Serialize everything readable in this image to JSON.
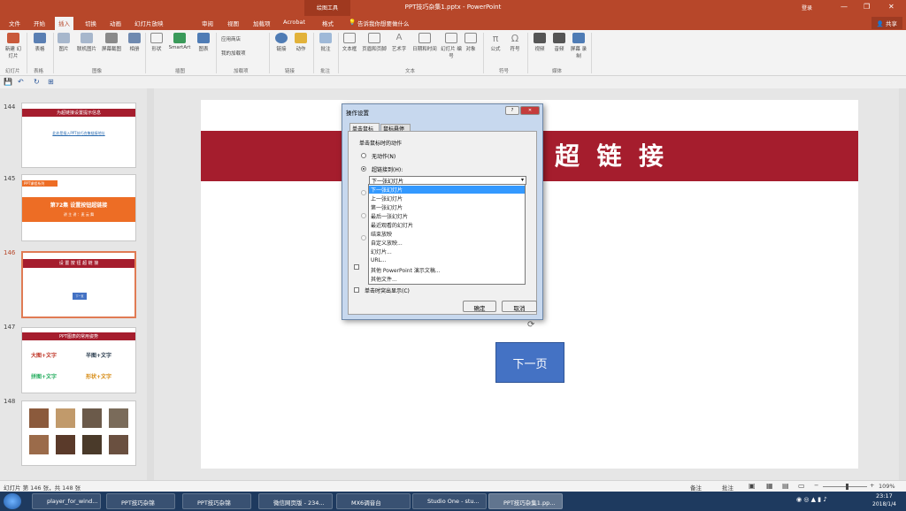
{
  "window": {
    "title": "PPT技巧杂集1.pptx  -  PowerPoint",
    "context_tab_group": "绘图工具",
    "login": "登录",
    "min": "—",
    "max": "❐",
    "close": "✕"
  },
  "tabs": [
    "文件",
    "开始",
    "插入",
    "切换",
    "动画",
    "幻灯片放映",
    "审阅",
    "视图",
    "加载项",
    "Acrobat",
    "格式"
  ],
  "active_tab": "插入",
  "tell_me": "告诉我你想要做什么",
  "share_label": "共享",
  "ribbon": {
    "buttons": [
      "新建\n幻灯片",
      "表格",
      "图片",
      "联机图片",
      "屏幕截图",
      "相册",
      "形状",
      "SmartArt",
      "图表",
      "应用商店",
      "我的加载项",
      "链接",
      "动作",
      "批注",
      "文本框",
      "页眉和页脚",
      "艺术字",
      "日期和时间",
      "幻灯片\n编号",
      "对象",
      "公式",
      "符号",
      "视频",
      "音频",
      "屏幕\n录制"
    ],
    "groups": [
      "幻灯片",
      "表格",
      "图像",
      "插图",
      "加载项",
      "链接",
      "批注",
      "文本",
      "符号",
      "媒体"
    ]
  },
  "quick_access": [
    "💾",
    "↶",
    "↻",
    "⊞"
  ],
  "thumbnails": [
    {
      "num": "144",
      "title": "为超链接设置提示信息",
      "body": "此处是插入PPT技巧合集链接地址"
    },
    {
      "num": "145",
      "tag": "PPT课程系列",
      "title": "第72集  设置按钮超链接",
      "sub": "讲 主 讲 ：麦 云 舞"
    },
    {
      "num": "146",
      "title": "设 置 按 钮 超 链 接",
      "btn": "下一页"
    },
    {
      "num": "147",
      "title": "PPT图表的常用姿势",
      "items": [
        "大图+文字",
        "半图+文字",
        "拼图+文字",
        "形状+文字"
      ]
    },
    {
      "num": "148"
    }
  ],
  "slide": {
    "banner_title": "超  链  接",
    "next_button": "下一页"
  },
  "dialog": {
    "title": "操作设置",
    "help": "?",
    "close": "✕",
    "tabs": [
      "单击鼠标",
      "鼠标悬停"
    ],
    "section": "单击鼠标时的动作",
    "options": [
      "无动作(N)",
      "超链接到(H):"
    ],
    "combo_value": "下一张幻灯片",
    "list_items": [
      "下一张幻灯片",
      "上一张幻灯片",
      "第一张幻灯片",
      "最后一张幻灯片",
      "最近观看的幻灯片",
      "结束放映",
      "自定义放映...",
      "幻灯片...",
      "URL...",
      "其他 PowerPoint 演示文稿...",
      "其他文件..."
    ],
    "check_label": "单击时突出显示(C)",
    "ok": "确定",
    "cancel": "取消"
  },
  "statusbar": {
    "slide_info": "幻灯片 第 146 张，共 148 张",
    "notes": "备注",
    "comments": "批注",
    "zoom": "109%"
  },
  "taskbar": {
    "items": [
      "player_for_wind...",
      "PPT技巧杂锦",
      "PPT技巧杂锦",
      "微信网页版 - 234...",
      "MX6调音台",
      "Studio One - stu...",
      "PPT技巧杂集1.pp..."
    ],
    "time": "23:17",
    "date": "2018/1/4"
  }
}
